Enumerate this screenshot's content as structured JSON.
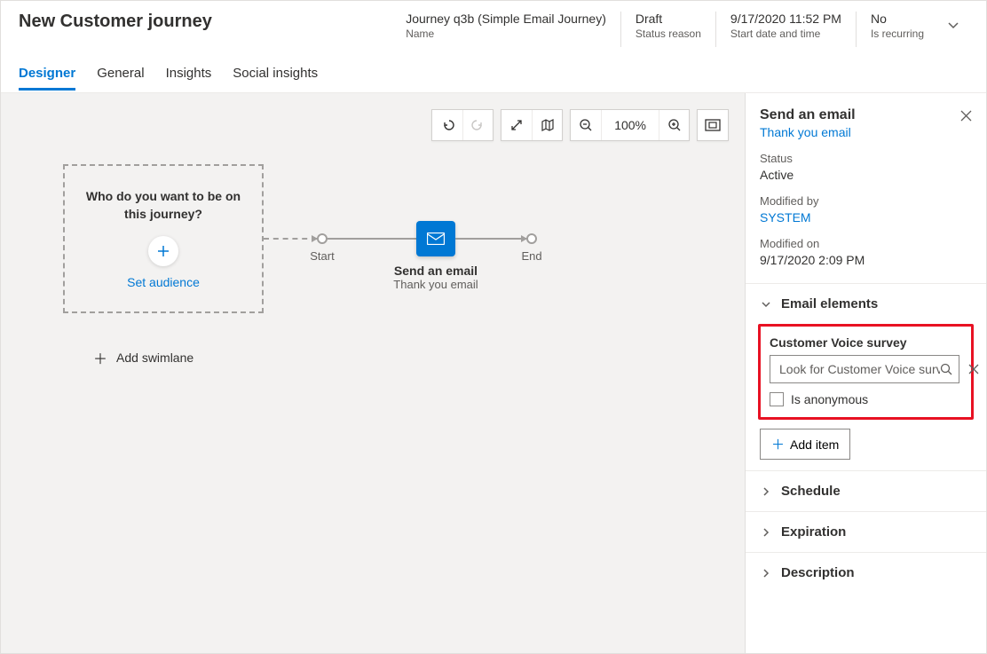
{
  "header": {
    "title": "New Customer journey",
    "fields": [
      {
        "value": "Journey q3b (Simple Email Journey)",
        "label": "Name"
      },
      {
        "value": "Draft",
        "label": "Status reason"
      },
      {
        "value": "9/17/2020 11:52 PM",
        "label": "Start date and time"
      },
      {
        "value": "No",
        "label": "Is recurring"
      }
    ]
  },
  "tabs": [
    "Designer",
    "General",
    "Insights",
    "Social insights"
  ],
  "toolbar": {
    "zoom": "100%"
  },
  "canvas": {
    "audience": {
      "question": "Who do you want to be on this journey?",
      "cta": "Set audience"
    },
    "start_label": "Start",
    "end_label": "End",
    "email_tile": {
      "title": "Send an email",
      "subtitle": "Thank you email"
    },
    "add_swimlane": "Add swimlane"
  },
  "side": {
    "title": "Send an email",
    "subtitle_link": "Thank you email",
    "meta": {
      "status_lbl": "Status",
      "status_val": "Active",
      "modby_lbl": "Modified by",
      "modby_val": "SYSTEM",
      "modon_lbl": "Modified on",
      "modon_val": "9/17/2020 2:09 PM"
    },
    "sections": {
      "email_elements": "Email elements",
      "schedule": "Schedule",
      "expiration": "Expiration",
      "description": "Description"
    },
    "survey": {
      "label": "Customer Voice survey",
      "placeholder": "Look for Customer Voice survey",
      "anon_label": "Is anonymous"
    },
    "add_item": "Add item"
  }
}
